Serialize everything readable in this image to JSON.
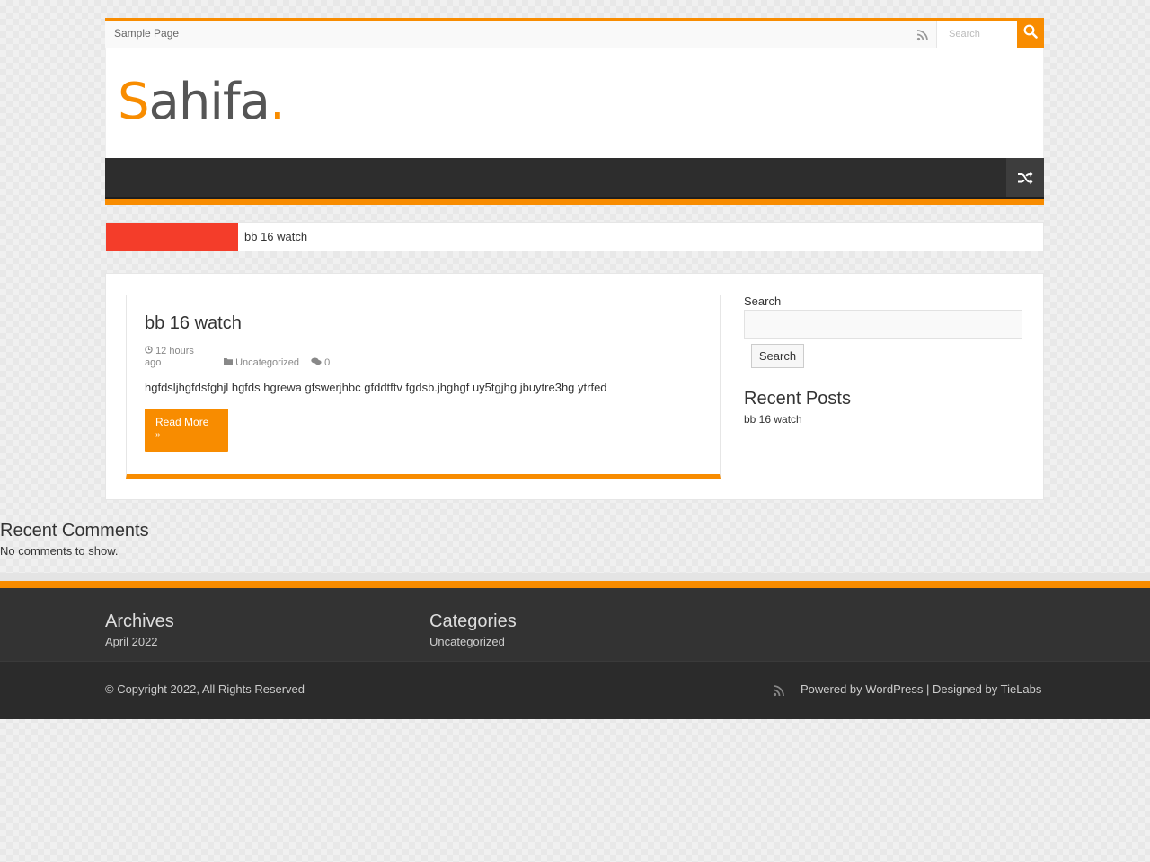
{
  "topbar": {
    "nav_items": [
      "Sample Page"
    ],
    "search_placeholder": "Search"
  },
  "header": {
    "logo_first": "S",
    "logo_rest": "ahifa",
    "logo_dot": "."
  },
  "breaking": {
    "item": "bb 16 watch"
  },
  "post": {
    "title": "bb 16 watch",
    "time": "12 hours ago",
    "category": "Uncategorized",
    "comments": "0",
    "excerpt": "hgfdsljhgfdsfghjl hgfds hgrewa gfswerjhbc gfddtftv fgdsb.jhghgf uy5tgjhg jbuytre3hg ytrfed",
    "read_more": "Read More",
    "read_more_arrow": "»"
  },
  "sidebar": {
    "search_label": "Search",
    "search_button": "Search",
    "recent_posts_title": "Recent Posts",
    "recent_posts": [
      "bb 16 watch"
    ]
  },
  "recent_comments": {
    "title": "Recent Comments",
    "empty": "No comments to show."
  },
  "footer": {
    "archives_title": "Archives",
    "archives_items": [
      "April 2022"
    ],
    "categories_title": "Categories",
    "categories_items": [
      "Uncategorized"
    ],
    "copyright": "© Copyright 2022, All Rights Reserved",
    "powered_prefix": "Powered by",
    "powered_wordpress": "WordPress",
    "designed_by": "| Designed by",
    "designer": "TieLabs"
  },
  "colors": {
    "accent": "#f88c00",
    "breaking_red": "#f43d2a",
    "nav_dark": "#2d2d2d",
    "footer_dark": "#333333"
  },
  "icons": [
    "rss-icon",
    "search-icon",
    "random-shuffle-icon",
    "clock-icon",
    "folder-icon",
    "comments-icon"
  ]
}
